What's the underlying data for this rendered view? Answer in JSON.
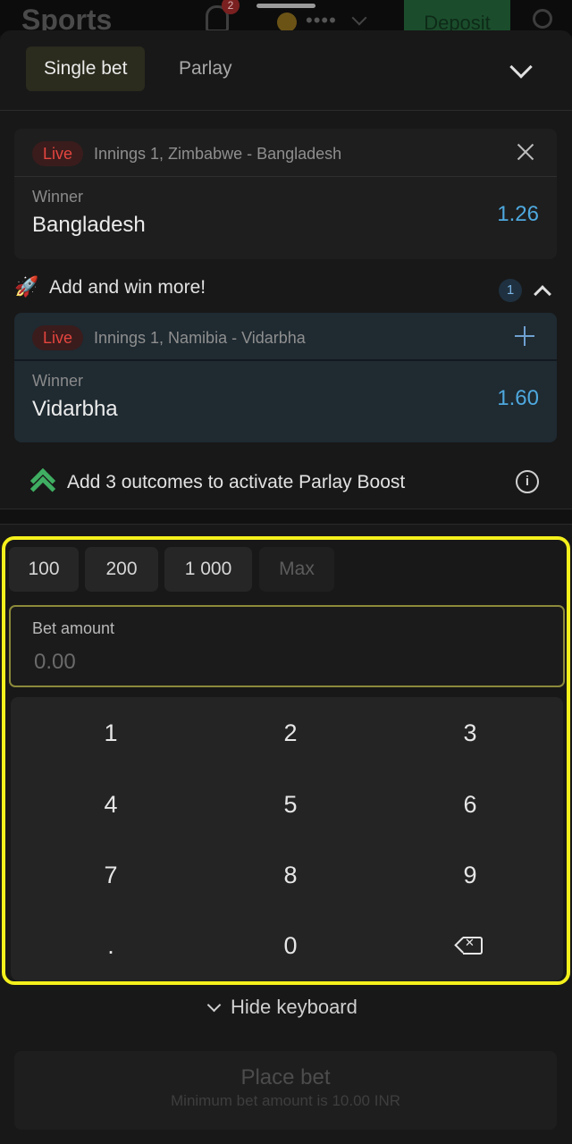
{
  "app": {
    "title": "Sports",
    "notification_count": "2",
    "balance_masked": "••••",
    "deposit_label": "Deposit"
  },
  "betslip": {
    "tabs": [
      {
        "label": "Single bet",
        "active": true
      },
      {
        "label": "Parlay",
        "active": false
      }
    ],
    "selected_bet": {
      "live_label": "Live",
      "event": "Innings 1, Zimbabwe - Bangladesh",
      "market": "Winner",
      "outcome": "Bangladesh",
      "odds": "1.26"
    },
    "add_and_win": {
      "label": "Add and win more!",
      "count": "1",
      "suggestion": {
        "live_label": "Live",
        "event": "Innings 1, Namibia - Vidarbha",
        "market": "Winner",
        "outcome": "Vidarbha",
        "odds": "1.60"
      }
    },
    "parlay_boost": "Add 3 outcomes to activate Parlay Boost",
    "quick_amounts": [
      "100",
      "200",
      "1 000",
      "Max"
    ],
    "bet_amount": {
      "label": "Bet amount",
      "placeholder": "0.00"
    },
    "keypad": [
      "1",
      "2",
      "3",
      "4",
      "5",
      "6",
      "7",
      "8",
      "9",
      ".",
      "0"
    ],
    "hide_keyboard": "Hide keyboard",
    "place_bet": {
      "label": "Place bet",
      "note": "Minimum bet amount is 10.00 INR"
    }
  },
  "colors": {
    "accent_blue": "#4ea8de",
    "live_red": "#e4453f",
    "highlight_yellow": "#f4f01c",
    "boost_green": "#3fae62"
  }
}
